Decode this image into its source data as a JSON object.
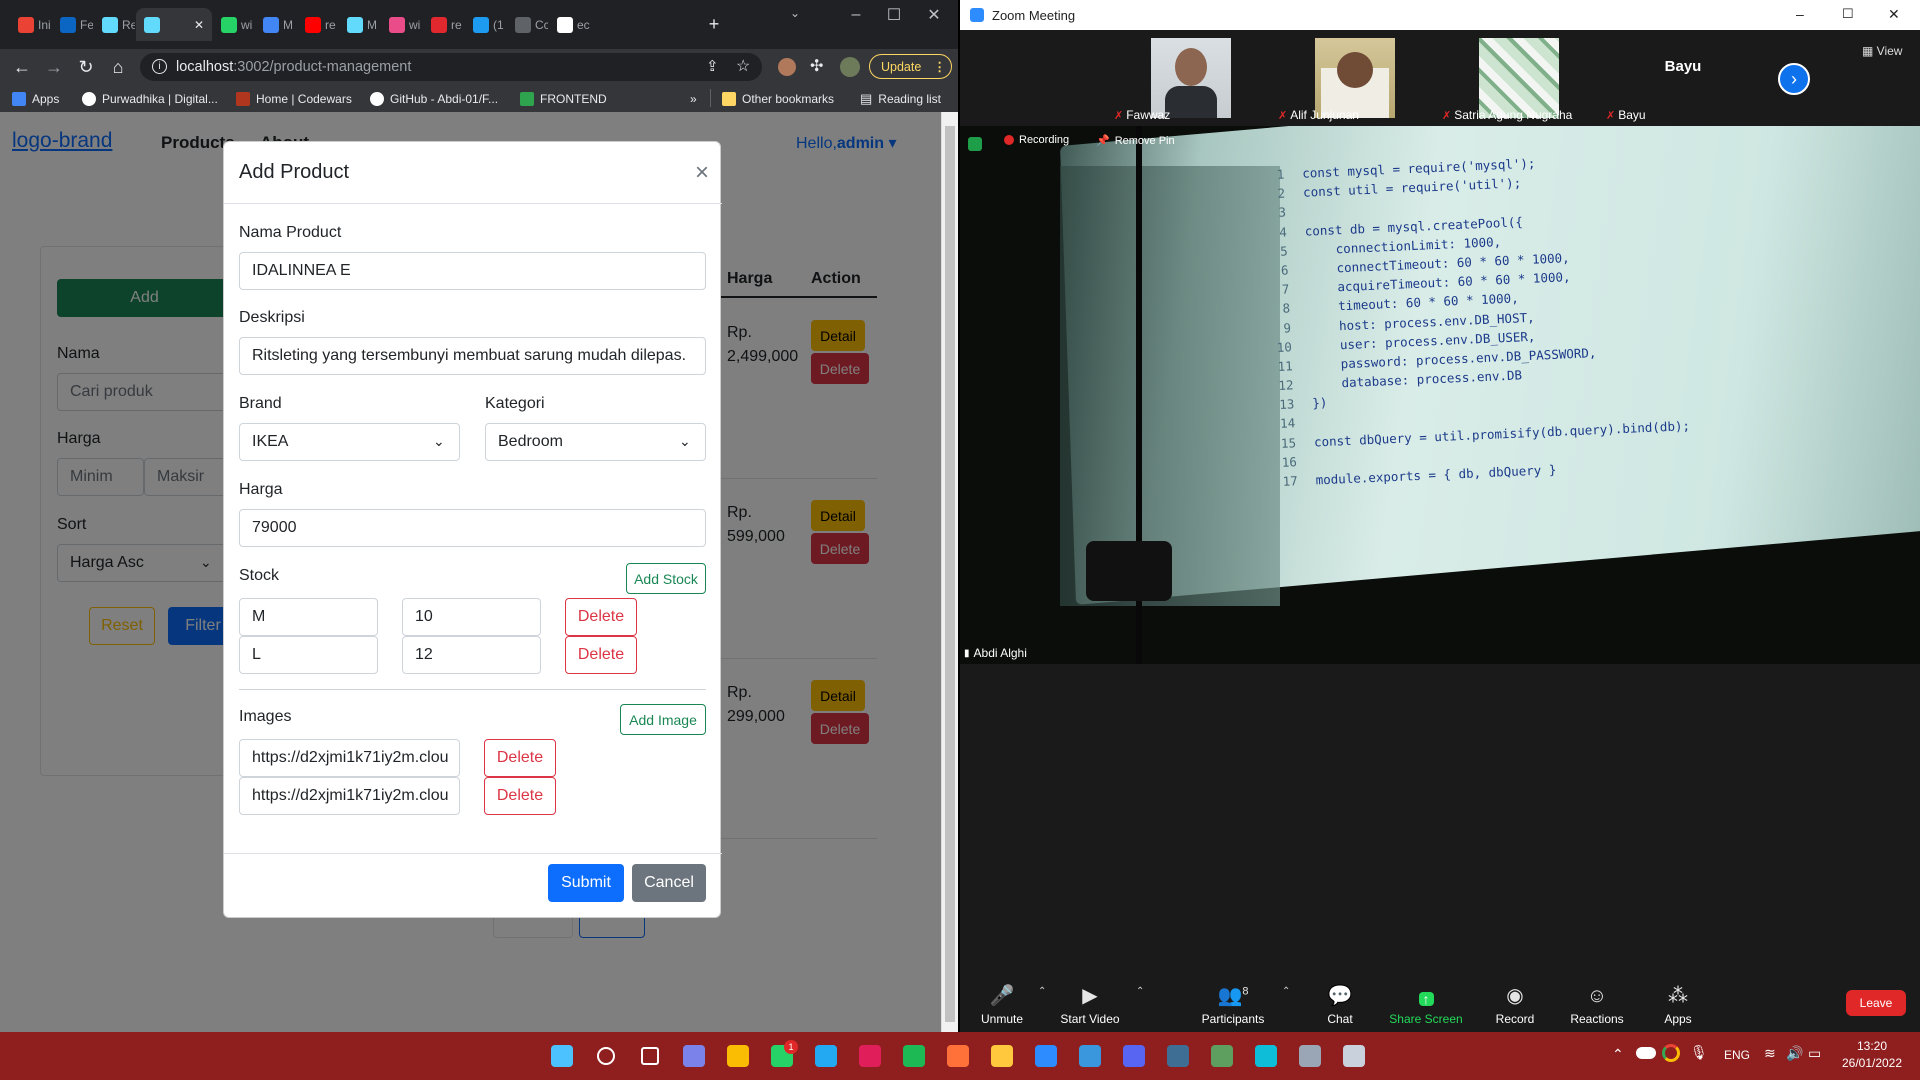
{
  "chrome": {
    "tabs": [
      {
        "label": "Ini",
        "color": "#ea4335"
      },
      {
        "label": "Fe",
        "color": "#0a66c2"
      },
      {
        "label": "Re",
        "color": "#61dafb"
      },
      {
        "label": "",
        "color": "#61dafb"
      },
      {
        "label": "wi",
        "color": "#25d366"
      },
      {
        "label": "M",
        "color": "#4285f4"
      },
      {
        "label": "re",
        "color": "#ff0000"
      },
      {
        "label": "M",
        "color": "#61dafb"
      },
      {
        "label": "wi",
        "color": "#ea4c89"
      },
      {
        "label": "re",
        "color": "#e0282e"
      },
      {
        "label": "(1",
        "color": "#1d9bf0"
      },
      {
        "label": "Cc",
        "color": "#5f6368"
      },
      {
        "label": "ec",
        "color": "#ffffff"
      }
    ],
    "url_host": "localhost",
    "url_path": ":3002/product-management",
    "update_label": "Update",
    "bookmarks": [
      {
        "label": "Apps",
        "color": "#4285f4"
      },
      {
        "label": "Purwadhika | Digital...",
        "color": "#ffffff"
      },
      {
        "label": "Home | Codewars",
        "color": "#b1361e"
      },
      {
        "label": "GitHub - Abdi-01/F...",
        "color": "#ffffff"
      },
      {
        "label": "FRONTEND",
        "color": "#2ea44f"
      }
    ],
    "bookmarks_more": "»",
    "other_bookmarks": "Other bookmarks",
    "reading_list": "Reading list"
  },
  "page": {
    "brand_alt": "logo-brand",
    "nav_products": "Products",
    "nav_about": "About",
    "hello": "Hello,",
    "user": "admin",
    "add_label": "Add",
    "filter": {
      "nama_label": "Nama",
      "nama_placeholder": "Cari produk",
      "harga_label": "Harga",
      "min_placeholder": "Minim",
      "max_placeholder": "Maksir",
      "sort_label": "Sort",
      "sort_value": "Harga Asc",
      "reset_label": "Reset",
      "filter_label": "Filter"
    },
    "table": {
      "col_harga": "Harga",
      "col_action": "Action",
      "detail_label": "Detail",
      "delete_label": "Delete",
      "rows": [
        {
          "currency": "Rp.",
          "price": "2,499,000"
        },
        {
          "currency": "Rp.",
          "price": "599,000"
        },
        {
          "currency": "Rp.",
          "price": "299,000"
        }
      ]
    }
  },
  "modal": {
    "title": "Add Product",
    "close": "×",
    "nama_label": "Nama Product",
    "nama_value": "IDALINNEA E",
    "deskripsi_label": "Deskripsi",
    "deskripsi_value": "Ritsleting yang tersembunyi membuat sarung mudah dilepas.",
    "brand_label": "Brand",
    "brand_value": "IKEA",
    "kategori_label": "Kategori",
    "kategori_value": "Bedroom",
    "harga_label": "Harga",
    "harga_value": "79000",
    "stock_label": "Stock",
    "add_stock_label": "Add Stock",
    "stocks": [
      {
        "size": "M",
        "qty": "10"
      },
      {
        "size": "L",
        "qty": "12"
      }
    ],
    "images_label": "Images",
    "add_image_label": "Add Image",
    "images": [
      "https://d2xjmi1k71iy2m.clou",
      "https://d2xjmi1k71iy2m.clou"
    ],
    "delete_label": "Delete",
    "submit_label": "Submit",
    "cancel_label": "Cancel"
  },
  "zoom": {
    "title": "Zoom Meeting",
    "view_label": "View",
    "participants": [
      {
        "name": "Fawwaz"
      },
      {
        "name": "Alif Junjunan"
      },
      {
        "name": "Satria Agung Nugraha"
      },
      {
        "name": "Bayu"
      }
    ],
    "bayu_tile": "Bayu",
    "recording_label": "Recording",
    "remove_pin_label": "Remove Pin",
    "sharer_name": "Abdi Alghi",
    "code_lines": [
      {
        "n": "1",
        "t": "const mysql = require('mysql');"
      },
      {
        "n": "2",
        "t": "const util = require('util');"
      },
      {
        "n": "3",
        "t": ""
      },
      {
        "n": "4",
        "t": "const db = mysql.createPool({"
      },
      {
        "n": "5",
        "t": "    connectionLimit: 1000,"
      },
      {
        "n": "6",
        "t": "    connectTimeout: 60 * 60 * 1000,"
      },
      {
        "n": "7",
        "t": "    acquireTimeout: 60 * 60 * 1000,"
      },
      {
        "n": "8",
        "t": "    timeout: 60 * 60 * 1000,"
      },
      {
        "n": "9",
        "t": "    host: process.env.DB_HOST,"
      },
      {
        "n": "10",
        "t": "    user: process.env.DB_USER,"
      },
      {
        "n": "11",
        "t": "    password: process.env.DB_PASSWORD,"
      },
      {
        "n": "12",
        "t": "    database: process.env.DB"
      },
      {
        "n": "13",
        "t": "})"
      },
      {
        "n": "14",
        "t": ""
      },
      {
        "n": "15",
        "t": "const dbQuery = util.promisify(db.query).bind(db);"
      },
      {
        "n": "16",
        "t": ""
      },
      {
        "n": "17",
        "t": "module.exports = { db, dbQuery }"
      }
    ],
    "toolbar": {
      "unmute": "Unmute",
      "start_video": "Start Video",
      "participants": "Participants",
      "participants_count": "8",
      "chat": "Chat",
      "share_screen": "Share Screen",
      "record": "Record",
      "reactions": "Reactions",
      "apps": "Apps",
      "leave": "Leave"
    }
  },
  "taskbar": {
    "language": "ENG",
    "time": "13:20",
    "date": "26/01/2022",
    "whatsapp_badge": "1",
    "apps": [
      {
        "name": "windows-start-icon",
        "color": "#4cc2ff"
      },
      {
        "name": "search-icon",
        "color": "#ffffff"
      },
      {
        "name": "task-view-icon",
        "color": "#ffffff"
      },
      {
        "name": "teams-chat-icon",
        "color": "#7b83eb"
      },
      {
        "name": "chrome-icon",
        "color": "#fbbc04"
      },
      {
        "name": "whatsapp-icon",
        "color": "#25d366"
      },
      {
        "name": "vscode-icon",
        "color": "#23a9f2"
      },
      {
        "name": "slack-icon",
        "color": "#e01e5a"
      },
      {
        "name": "spotify-icon",
        "color": "#1db954"
      },
      {
        "name": "firefox-icon",
        "color": "#ff7139"
      },
      {
        "name": "file-explorer-icon",
        "color": "#ffc83d"
      },
      {
        "name": "zoom-icon",
        "color": "#2d8cff"
      },
      {
        "name": "notepad-icon",
        "color": "#3a96dd"
      },
      {
        "name": "discord-icon",
        "color": "#5865f2"
      },
      {
        "name": "mysql-workbench-icon",
        "color": "#3e6e93"
      },
      {
        "name": "chrome-dev-icon",
        "color": "#5e9e5e"
      },
      {
        "name": "edge-icon",
        "color": "#0ebdd8"
      },
      {
        "name": "settings-icon",
        "color": "#9aa6b5"
      },
      {
        "name": "calculator-icon",
        "color": "#c9d1dd"
      }
    ]
  }
}
